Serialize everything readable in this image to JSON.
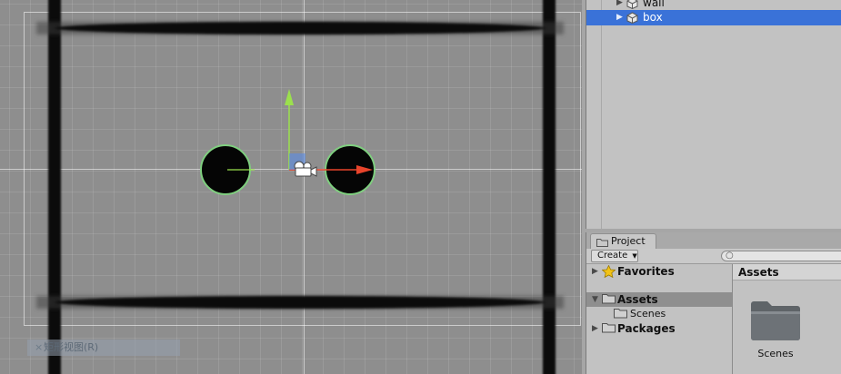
{
  "scene": {
    "overlay_label": "矩形视图(R)"
  },
  "hierarchy": {
    "items": [
      {
        "label": "wall",
        "selected": false
      },
      {
        "label": "box",
        "selected": true
      }
    ]
  },
  "project": {
    "tab_label": "Project",
    "create_label": "Create",
    "tree": {
      "favorites": "Favorites",
      "assets": "Assets",
      "scenes": "Scenes",
      "packages": "Packages"
    },
    "content": {
      "header": "Assets",
      "folder_label": "Scenes"
    }
  },
  "colors": {
    "selection": "#3a72d8",
    "y_axis": "#9be04d",
    "x_axis": "#e8442b",
    "collider": "#7fcf7f"
  },
  "icons": [
    "gameobject-cube-icon",
    "folder-icon",
    "star-icon",
    "search-icon",
    "camera-gizmo-icon"
  ]
}
